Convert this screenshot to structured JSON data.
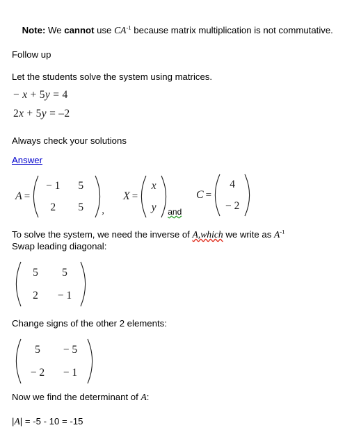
{
  "document": {
    "background_color": "#ffffff",
    "text_color": "#000000",
    "link_color": "#0000cc",
    "math_color": "#1a1a1a",
    "spellcheck_red": "#e03020",
    "spellcheck_green": "#1f9b1f"
  },
  "note": {
    "label": "Note:",
    "text_before": " We ",
    "emphasis": "cannot",
    "text_after": " use ",
    "math_expr": "CA",
    "math_exponent": "-1",
    "tail": " because matrix multiplication is not commutative."
  },
  "headings": {
    "follow_up": "Follow up",
    "instruction": "Let the students solve the system using matrices.",
    "always_check": "Always check your solutions",
    "answer_link": "Answer",
    "swap_intro_a": "To solve the system, we need the inverse of ",
    "swap_intro_spell": "A,which",
    "swap_intro_b": " we write as ",
    "swap_intro_sym": "A",
    "swap_intro_exp": "-1",
    "swap_line2": "Swap leading diagonal:",
    "change_signs": "Change signs of the other 2 elements:",
    "determinant_intro_a": "Now we find the determinant of ",
    "determinant_intro_sym": "A",
    "determinant_intro_b": ":",
    "determinant_result_a": "|",
    "determinant_result_sym": "A",
    "determinant_result_b": "| = -5 - 10 = -15"
  },
  "system": {
    "equation_1": "− x + 5y = 4",
    "eq1_parts": {
      "lead": "− ",
      "x": "x",
      "mid": " + 5",
      "y": "y",
      "rhs": " = 4"
    },
    "equation_2": "2x + 5y = –2",
    "eq2_parts": {
      "lead": "2",
      "x": "x",
      "mid": " + 5",
      "y": "y",
      "rhs": " = –2"
    }
  },
  "matrices": {
    "A": {
      "label": "A",
      "equals": "=",
      "rows": 2,
      "cols": 2,
      "cells": [
        [
          "− 1",
          "5"
        ],
        [
          "2",
          "5"
        ]
      ],
      "trailing": ","
    },
    "X": {
      "label": "X",
      "equals": "=",
      "rows": 2,
      "cols": 1,
      "cells": [
        [
          "x"
        ],
        [
          "y"
        ]
      ],
      "italic_cells": true,
      "trailing": "and"
    },
    "C": {
      "label": "C",
      "equals": "=",
      "rows": 2,
      "cols": 1,
      "cells": [
        [
          "4"
        ],
        [
          "− 2"
        ]
      ],
      "trailing": ""
    },
    "swapped": {
      "rows": 2,
      "cols": 2,
      "cells": [
        [
          "5",
          "5"
        ],
        [
          "2",
          "− 1"
        ]
      ]
    },
    "signs_changed": {
      "rows": 2,
      "cols": 2,
      "cells": [
        [
          "5",
          "− 5"
        ],
        [
          "− 2",
          "− 1"
        ]
      ]
    }
  },
  "chart_data": null
}
